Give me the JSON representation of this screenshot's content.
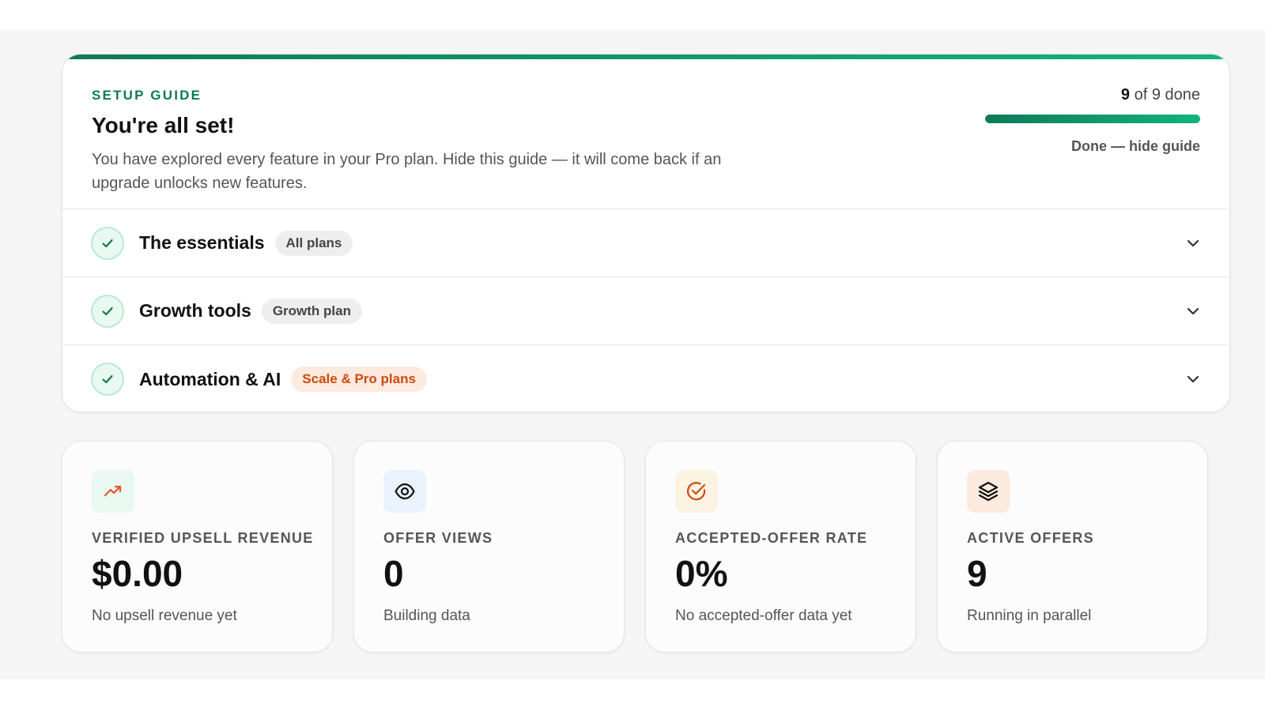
{
  "setup_guide": {
    "eyebrow": "SETUP GUIDE",
    "title": "You're all set!",
    "description": "You have explored every feature in your Pro plan. Hide this guide — it will come back if an upgrade unlocks new features.",
    "progress_done": "9",
    "progress_suffix": " of 9 done",
    "progress_fraction": 1.0,
    "hide_label": "Done — hide guide",
    "sections": [
      {
        "label": "The essentials",
        "plan": "All plans",
        "icon": "check-icon"
      },
      {
        "label": "Growth tools",
        "plan": "Growth plan",
        "icon": "check-icon"
      },
      {
        "label": "Automation & AI",
        "plan": "Scale & Pro plans",
        "icon": "check-icon"
      }
    ]
  },
  "stats": [
    {
      "label": "VERIFIED UPSELL REVENUE",
      "value": "$0.00",
      "sub": "No upsell revenue yet",
      "icon": "trending-up-icon",
      "icon_bg": "#e9f8f1",
      "icon_color": "#e8541d"
    },
    {
      "label": "OFFER VIEWS",
      "value": "0",
      "sub": "Building data",
      "icon": "eye-icon",
      "icon_bg": "#eaf2fd",
      "icon_color": "#111111"
    },
    {
      "label": "ACCEPTED-OFFER RATE",
      "value": "0%",
      "sub": "No accepted-offer data yet",
      "icon": "check-circle-icon",
      "icon_bg": "#fdf3e2",
      "icon_color": "#cc4a10"
    },
    {
      "label": "ACTIVE OFFERS",
      "value": "9",
      "sub": "Running in parallel",
      "icon": "layers-icon",
      "icon_bg": "#fdeadf",
      "icon_color": "#111111"
    }
  ],
  "colors": {
    "accent": "#0d7a50",
    "accent_bright": "#10b47e",
    "pill_orange": "#cc4a10"
  }
}
